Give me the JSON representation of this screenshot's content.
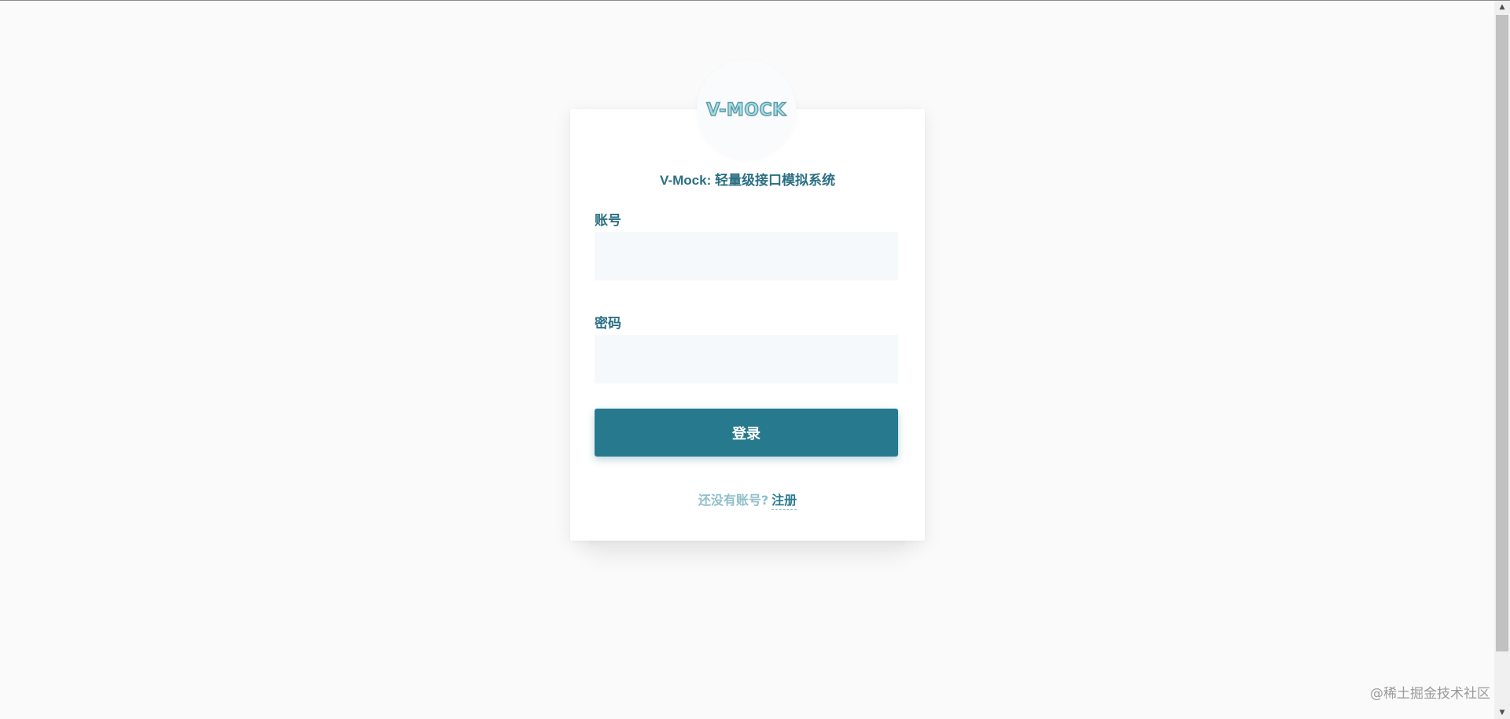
{
  "app": {
    "title": "V-Mock: 轻量级接口模拟系统",
    "logo_text": "V-MOCK"
  },
  "form": {
    "account_label": "账号",
    "account_value": "",
    "account_placeholder": "",
    "password_label": "密码",
    "password_value": "",
    "password_placeholder": "",
    "login_button": "登录"
  },
  "register": {
    "hint": "还没有账号?",
    "link": "注册"
  },
  "watermark": "@稀土掘金技术社区",
  "colors": {
    "primary": "#277a8e",
    "title_text": "#2b6f84",
    "hint_text": "#8fbfcb",
    "input_bg": "#f5f9fb",
    "page_bg": "#fafafa"
  },
  "icons": {
    "scroll_up": "scroll-up-arrow-icon",
    "scroll_down": "scroll-down-arrow-icon"
  }
}
